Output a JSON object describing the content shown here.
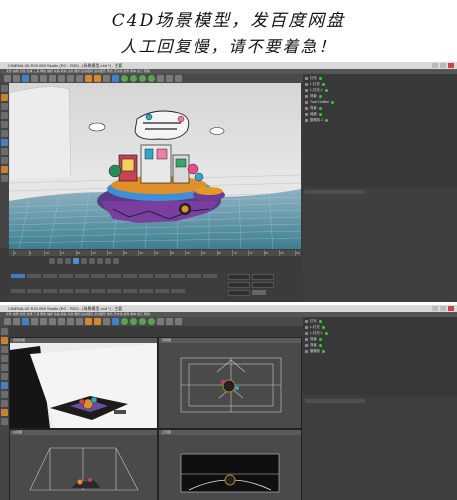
{
  "banner": {
    "line1": "C4D场景模型，发百度网盘",
    "line2": "人工回复慢，请不要着急！"
  },
  "top_window": {
    "title": "CINEMA 4D R20.059 Studio (RC - R20) - [场景模型.c4d *] - 主要",
    "menu": "文件  编辑  创建  选择  工具  网格  捕捉  动画  模拟  渲染  雕刻  运动跟踪  运动图形  角色  流水线  插件  脚本  窗口  帮助",
    "timeline_ticks": [
      "0",
      "5",
      "10",
      "15",
      "20",
      "25",
      "30",
      "35",
      "40",
      "45",
      "50",
      "55",
      "60",
      "65",
      "70",
      "75",
      "80",
      "85",
      "90"
    ],
    "objects": [
      {
        "label": "灯光",
        "has_dot": true
      },
      {
        "label": "L-灯光",
        "has_dot": true
      },
      {
        "label": "L-灯光.1",
        "has_dot": true
      },
      {
        "label": "场景",
        "has_dot": true
      },
      {
        "label": "Toon Outline",
        "has_dot": true
      },
      {
        "label": "背景",
        "has_dot": true
      },
      {
        "label": "地面",
        "has_dot": true
      },
      {
        "label": "摄像机.1",
        "has_dot": true
      }
    ]
  },
  "bottom_window": {
    "title": "CINEMA 4D R20.059 Studio (RC - R20) - [场景模型.c4d *] - 主要",
    "menu": "文件  编辑  创建  选择  工具  网格  捕捉  动画  模拟  渲染  雕刻  运动跟踪  运动图形  角色  流水线  插件  脚本  窗口  帮助",
    "viewports": [
      "透视视图",
      "顶视图",
      "右视图",
      "正视图"
    ],
    "objects": [
      {
        "label": "灯光",
        "has_dot": true
      },
      {
        "label": "L-灯光",
        "has_dot": true
      },
      {
        "label": "L-灯光.1",
        "has_dot": true
      },
      {
        "label": "场景",
        "has_dot": true
      },
      {
        "label": "背景",
        "has_dot": true
      },
      {
        "label": "摄像机",
        "has_dot": true
      }
    ]
  }
}
